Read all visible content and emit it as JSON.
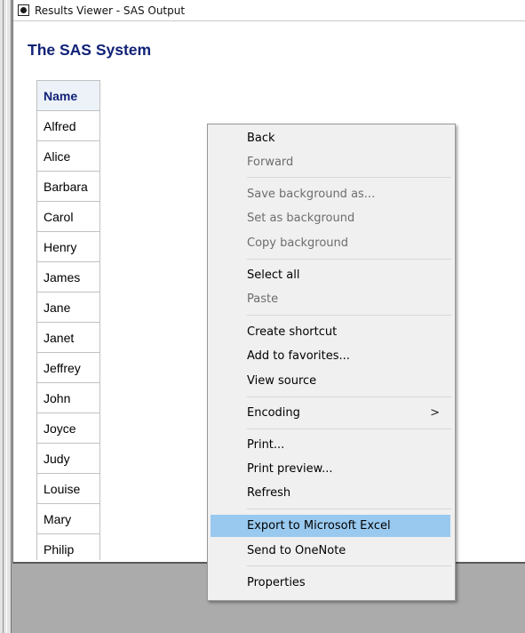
{
  "window": {
    "title": "Results Viewer - SAS Output"
  },
  "report": {
    "title": "The SAS System",
    "column_header": "Name",
    "names": [
      "Alfred",
      "Alice",
      "Barbara",
      "Carol",
      "Henry",
      "James",
      "Jane",
      "Janet",
      "Jeffrey",
      "John",
      "Joyce",
      "Judy",
      "Louise",
      "Mary",
      "Philip"
    ]
  },
  "context_menu": {
    "back": "Back",
    "forward": "Forward",
    "save_background": "Save background as...",
    "set_background": "Set as background",
    "copy_background": "Copy background",
    "select_all": "Select all",
    "paste": "Paste",
    "create_shortcut": "Create shortcut",
    "add_favorites": "Add to favorites...",
    "view_source": "View source",
    "encoding": "Encoding",
    "encoding_arrow": ">",
    "print": "Print...",
    "print_preview": "Print preview...",
    "refresh": "Refresh",
    "export_excel": "Export to Microsoft Excel",
    "send_onenote": "Send to OneNote",
    "properties": "Properties",
    "highlight_color": "#99c9ef"
  }
}
